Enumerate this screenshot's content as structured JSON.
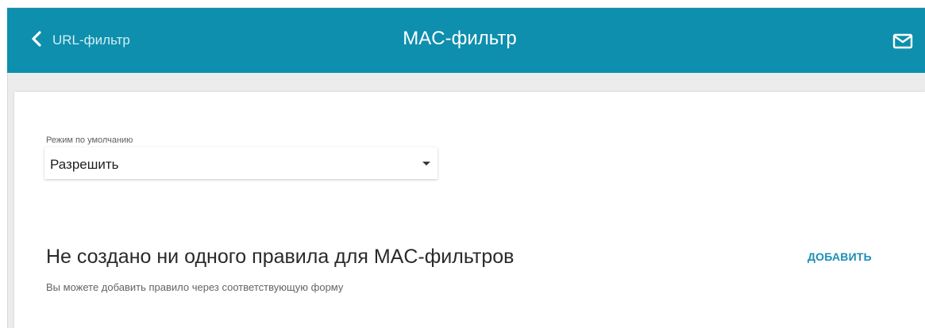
{
  "header": {
    "back_label": "URL-фильтр",
    "title": "MAC-фильтр",
    "mail_icon": "mail-icon",
    "back_icon": "chevron-left-icon"
  },
  "form": {
    "mode_label": "Режим по умолчанию",
    "mode_value": "Разрешить"
  },
  "rules": {
    "empty_title": "Не создано ни одного правила для MAC-фильтров",
    "add_label": "ДОБАВИТЬ",
    "hint": "Вы можете добавить правило через соответствующую форму"
  },
  "colors": {
    "header_bg": "#0e8fae",
    "accent": "#1a8fb4"
  }
}
